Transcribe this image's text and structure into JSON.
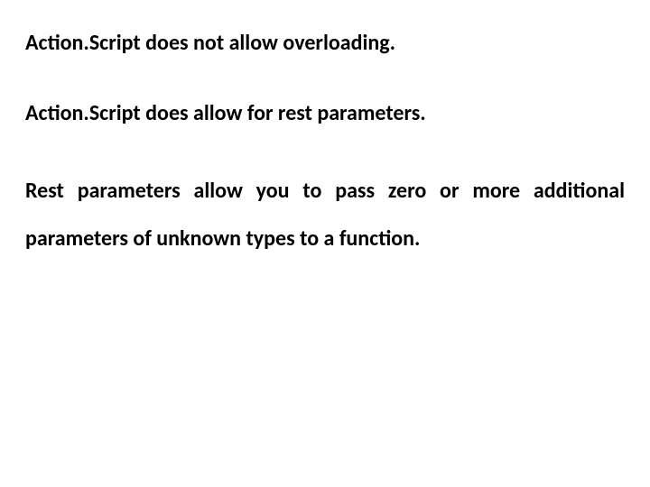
{
  "lines": {
    "l1": "Action.Script does not allow overloading.",
    "l2": "Action.Script does allow for rest parameters.",
    "l3": "Rest parameters allow you to pass zero or more additional parameters of unknown types to a function."
  }
}
